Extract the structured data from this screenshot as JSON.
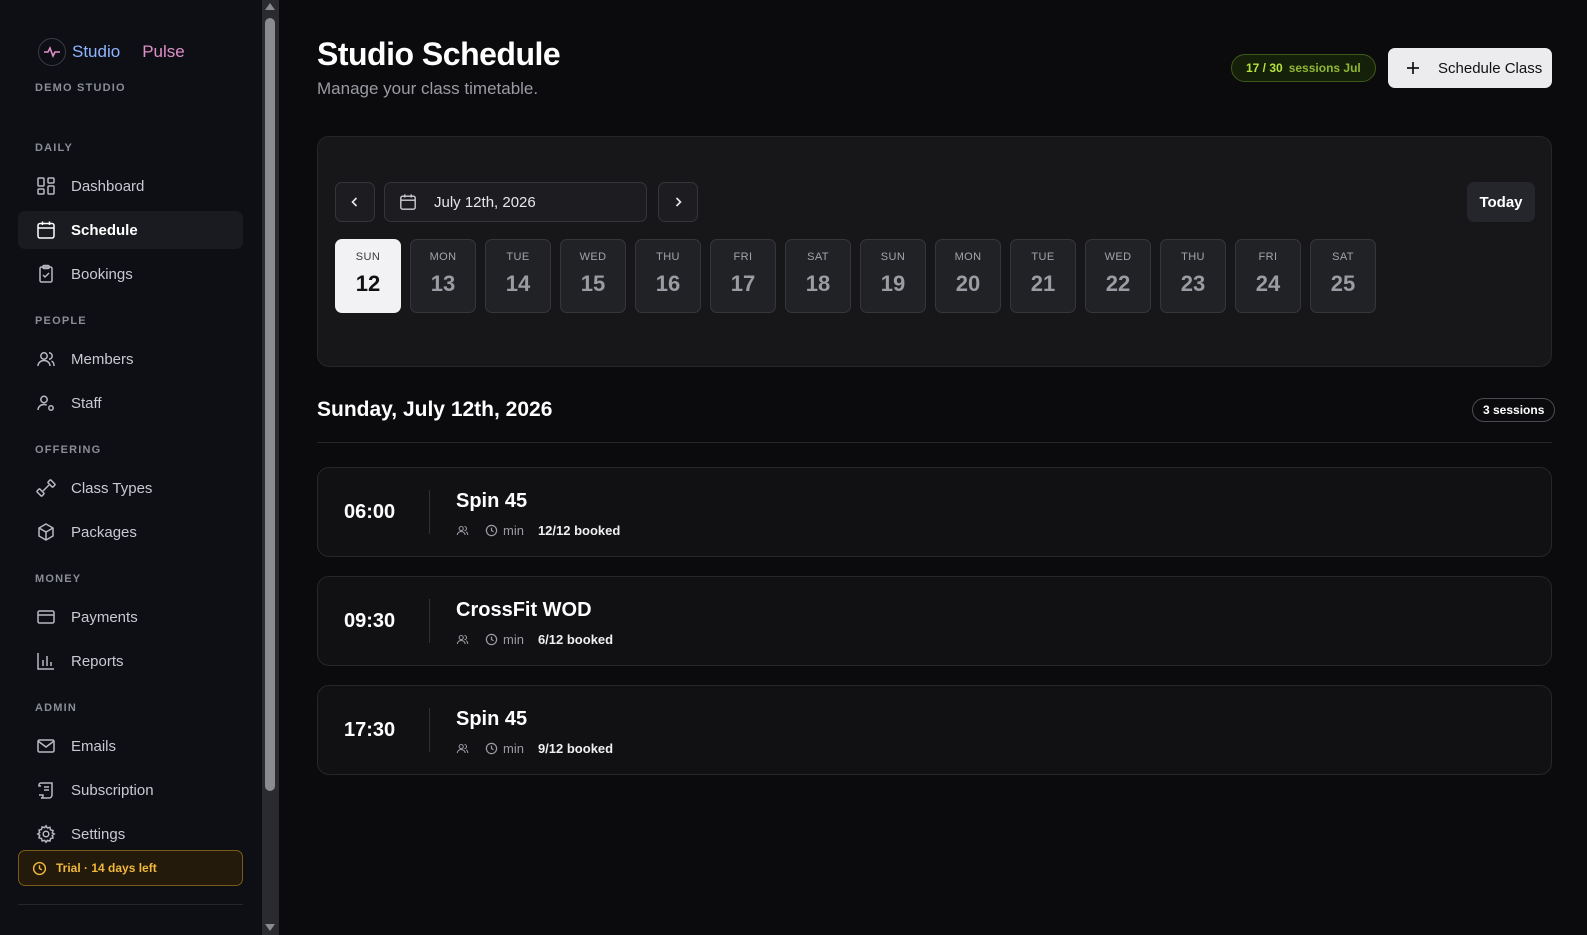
{
  "brand": {
    "name_part1": "Studio",
    "name_part2": "Pulse",
    "studio": "DEMO STUDIO"
  },
  "sidebar": {
    "sections": {
      "daily": "DAILY",
      "people": "PEOPLE",
      "offering": "OFFERING",
      "money": "MONEY",
      "admin": "ADMIN"
    },
    "items": [
      {
        "label": "Dashboard",
        "icon": "dashboard-icon"
      },
      {
        "label": "Schedule",
        "icon": "calendar-icon",
        "active": true
      },
      {
        "label": "Bookings",
        "icon": "clipboard-check-icon"
      },
      {
        "label": "Members",
        "icon": "users-icon"
      },
      {
        "label": "Staff",
        "icon": "user-cog-icon"
      },
      {
        "label": "Class Types",
        "icon": "dumbbell-icon"
      },
      {
        "label": "Packages",
        "icon": "package-icon"
      },
      {
        "label": "Payments",
        "icon": "credit-card-icon"
      },
      {
        "label": "Reports",
        "icon": "bar-chart-icon"
      },
      {
        "label": "Emails",
        "icon": "mail-icon"
      },
      {
        "label": "Subscription",
        "icon": "scroll-icon"
      },
      {
        "label": "Settings",
        "icon": "gear-icon"
      }
    ],
    "trial": "Trial · 14 days left"
  },
  "header": {
    "title": "Studio Schedule",
    "subtitle": "Manage your class timetable.",
    "usage_count": "17 / 30",
    "usage_label": "sessions Jul",
    "schedule_button": "Schedule Class"
  },
  "calendar": {
    "date_value": "July 12th, 2026",
    "today_label": "Today",
    "days": [
      {
        "dow": "SUN",
        "num": "12",
        "selected": true
      },
      {
        "dow": "MON",
        "num": "13"
      },
      {
        "dow": "TUE",
        "num": "14"
      },
      {
        "dow": "WED",
        "num": "15"
      },
      {
        "dow": "THU",
        "num": "16"
      },
      {
        "dow": "FRI",
        "num": "17"
      },
      {
        "dow": "SAT",
        "num": "18"
      },
      {
        "dow": "SUN",
        "num": "19"
      },
      {
        "dow": "MON",
        "num": "20"
      },
      {
        "dow": "TUE",
        "num": "21"
      },
      {
        "dow": "WED",
        "num": "22"
      },
      {
        "dow": "THU",
        "num": "23"
      },
      {
        "dow": "FRI",
        "num": "24"
      },
      {
        "dow": "SAT",
        "num": "25"
      }
    ]
  },
  "day_view": {
    "heading": "Sunday, July 12th, 2026",
    "sessions_count": "3 sessions",
    "sessions": [
      {
        "time": "06:00",
        "name": "Spin 45",
        "duration": "min",
        "booked": "12/12 booked"
      },
      {
        "time": "09:30",
        "name": "CrossFit WOD",
        "duration": "min",
        "booked": "6/12 booked"
      },
      {
        "time": "17:30",
        "name": "Spin 45",
        "duration": "min",
        "booked": "9/12 booked"
      }
    ]
  },
  "colors": {
    "accent_green": "#b6e33c",
    "trial_amber": "#f2b83b",
    "brand_blue": "#8fb4ff",
    "brand_pink": "#e08fc8"
  }
}
